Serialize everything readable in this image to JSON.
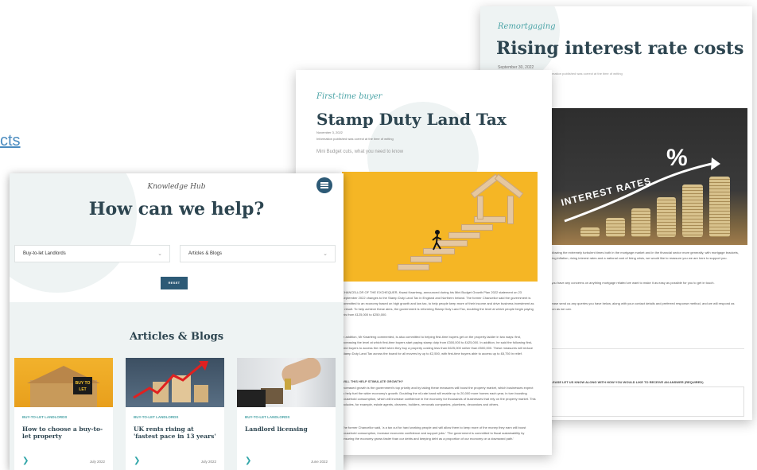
{
  "edge_link": {
    "label": "cts"
  },
  "back_page": {
    "category": "Remortgaging",
    "title": "Rising interest rate costs",
    "date": "September 30, 2022",
    "note": "Information published was correct at the time of writing",
    "image_text": "INTEREST RATES",
    "image_symbol": "%",
    "para1": "Following the extremely turbulent times both in the mortgage market and in the financial sector more generally, with mortgage brackets, rising inflation, rising interest rates and a national cost of living crisis, we would like to reassure you we are here to support you.",
    "para2": "If you have any concerns on anything mortgage related we want to make it as easy as possible for you to get in touch.",
    "para3": "Please send us any queries you have below, along with your contact details and preferred response method, and we will respond as soon as we can.",
    "question_label": "PLEASE LET US KNOW ALONG WITH HOW YOU WOULD LIKE TO RECEIVE AN ANSWER (REQUIRED)"
  },
  "mid_page": {
    "category": "First-time buyer",
    "title": "Stamp Duty Land Tax",
    "date": "November 3, 2022",
    "note": "Information published was correct at the time of writing",
    "lead": "Mini Budget cuts, what you need to know",
    "para1": "CHANCELLOR OF THE EXCHEQUER, Kwasi Kwarteng, announced during his Mini Budget Growth Plan 2022 statement on 23 September 2022 changes to the Stamp Duty Land Tax in England and Northern Ireland. The former Chancellor said the government is committed to an economy based on high growth and low tax, to help people keep more of their income and drive business investment as a result. To help achieve these aims, the government is reforming Stamp Duty Land Tax, doubling the level at which people begin paying this from £125,000 to £250,000.",
    "para2": "In addition, Mr Kwarteng commented, is also committed to helping first-time buyers get on the property ladder in two ways: first, increasing the level at which first-time buyers start paying stamp duty from £300,000 to £425,000. In addition, he said the following first-time buyers to access the relief when they buy a property costing less than £625,000 rather than £500,000. These measures will reduce Stamp Duty Land Tax across the board for all movers by up to £2,500, with first-time buyers able to access up to £8,750 in relief.",
    "subhead": "WILL THIS HELP STIMULATE GROWTH?",
    "para3": "Increased growth is the government's top priority and by taking these measures will boost the property market, which businesses expect to help fuel the wider economy's growth. Doubling the nil-rate band will enable up to 20,000 more homes each year, in turn boosting household consumption, which will increase confidence in the economy for thousands of businesses that rely on the property market. This includes, for example, estate agents, cleaners, builders, removals companies, plumbers, decorators and others.",
    "para4": "The former Chancellor said, 'a a tax cut for hard working people and will allow them to keep more of the money they earn will boost household consumption, increase economic confidence and support jobs.' 'The government is committed to fiscal sustainability by ensuring the economy grows faster than our debts and keeping debt as a proportion of our economy on a downward path.'"
  },
  "front_page": {
    "brand": "Knowledge Hub",
    "heading": "How can we help?",
    "filter1": "Buy-to-let Landlords",
    "filter2": "Articles & Blogs",
    "reset_label": "RESET",
    "section_heading": "Articles & Blogs",
    "articles": [
      {
        "category": "BUY-TO-LET LANDLORDS",
        "title": "How to choose a buy-to-let property",
        "date": "July 2022",
        "sign_text": "BUY TO LET"
      },
      {
        "category": "BUY-TO-LET LANDLORDS",
        "title": "UK rents rising at 'fastest pace in 13 years'",
        "date": "July 2022"
      },
      {
        "category": "BUY-TO-LET LANDLORDS",
        "title": "Landlord licensing",
        "date": "June 2022"
      }
    ]
  },
  "colors": {
    "navy": "#2d4550",
    "teal": "#4aa3a6",
    "button": "#2d5a76",
    "mint": "#eef3f3",
    "yellow": "#f5b625"
  },
  "icons": [
    "hamburger-menu-icon",
    "chevron-down-icon",
    "chevron-right-icon"
  ]
}
